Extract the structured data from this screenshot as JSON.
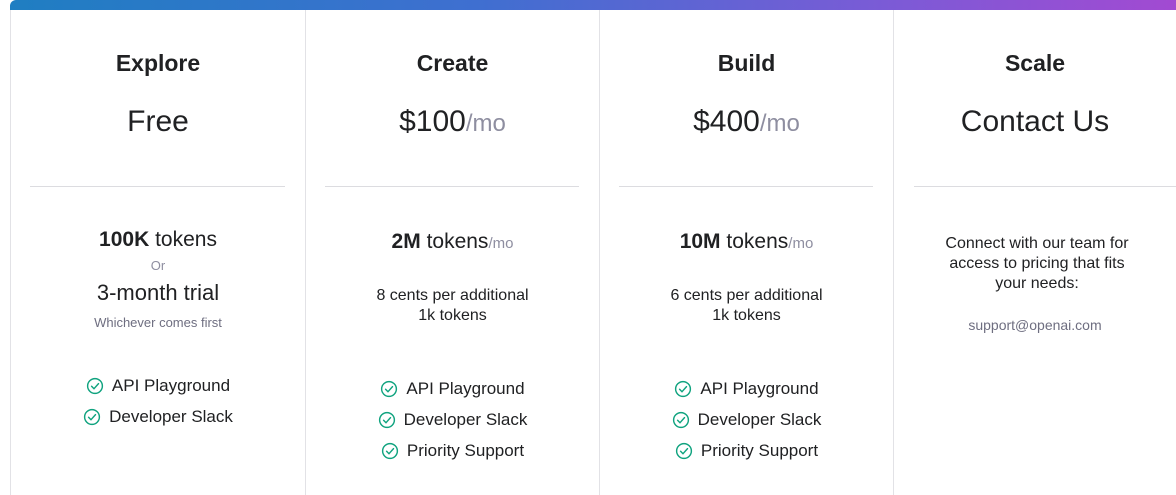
{
  "colors": {
    "accent_check": "#10a37f",
    "muted": "#8e8ea0",
    "divider": "#dcdce0"
  },
  "tiers": [
    {
      "name": "Explore",
      "price": "Free",
      "quota_amount": "100K",
      "quota_unit": "tokens",
      "or_label": "Or",
      "trial": "3-month trial",
      "whichever": "Whichever comes first",
      "features": [
        "API Playground",
        "Developer Slack"
      ]
    },
    {
      "name": "Create",
      "price": "$100",
      "price_unit": "/mo",
      "quota_amount": "2M",
      "quota_unit": "tokens",
      "quota_per": "/mo",
      "extra_line1": "8 cents per additional",
      "extra_line2": "1k tokens",
      "features": [
        "API Playground",
        "Developer Slack",
        "Priority Support"
      ]
    },
    {
      "name": "Build",
      "price": "$400",
      "price_unit": "/mo",
      "quota_amount": "10M",
      "quota_unit": "tokens",
      "quota_per": "/mo",
      "extra_line1": "6 cents per additional",
      "extra_line2": "1k tokens",
      "features": [
        "API Playground",
        "Developer Slack",
        "Priority Support"
      ]
    },
    {
      "name": "Scale",
      "price": "Contact Us",
      "contact_line1": "Connect with our team for",
      "contact_line2": "access to pricing that fits",
      "contact_line3": "your needs:",
      "email": "support@openai.com",
      "features": []
    }
  ]
}
